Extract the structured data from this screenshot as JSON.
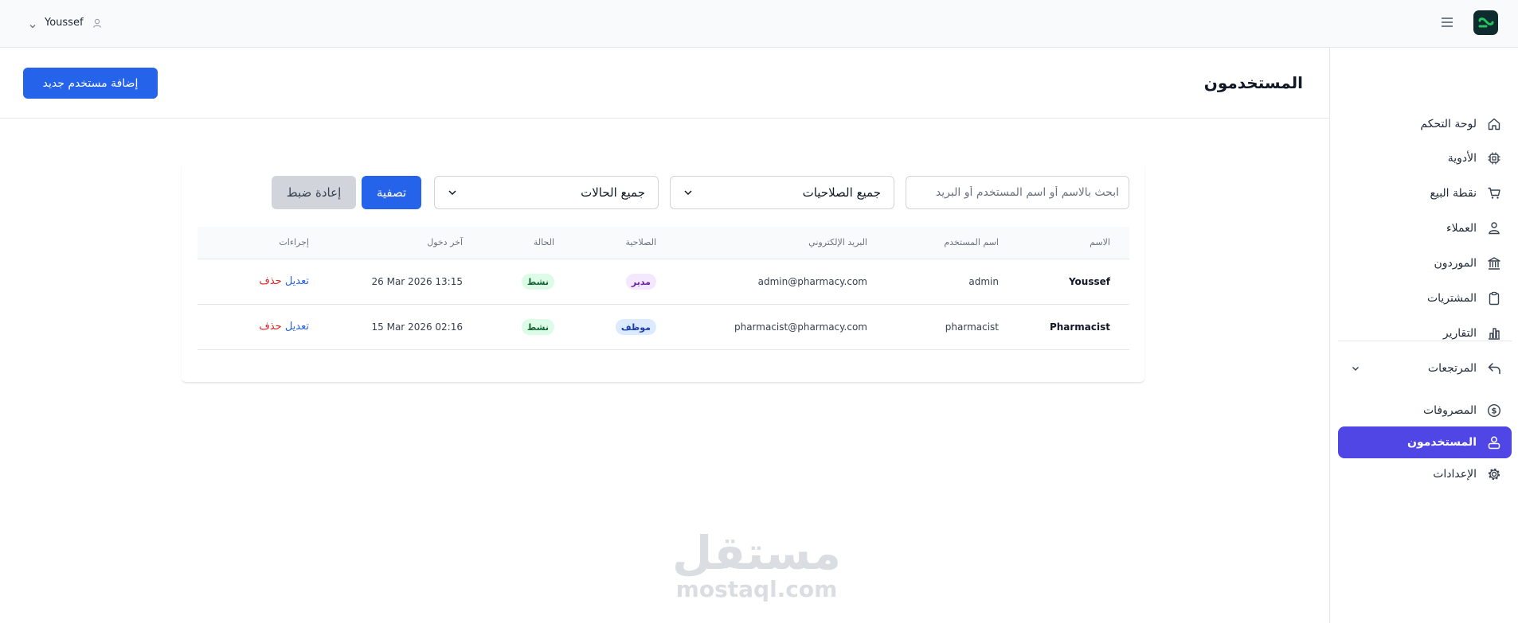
{
  "topbar": {
    "user_name": "Youssef",
    "icons": [
      "chevron-down-icon",
      "user-icon",
      "menu-icon",
      "logo"
    ]
  },
  "sidebar": {
    "items": [
      {
        "label": "لوحة التحكم",
        "icon": "home-icon"
      },
      {
        "label": "الأدوية",
        "icon": "pill-icon"
      },
      {
        "label": "نقطة البيع",
        "icon": "cart-icon"
      },
      {
        "label": "العملاء",
        "icon": "customers-icon"
      },
      {
        "label": "الموردون",
        "icon": "building-icon"
      },
      {
        "label": "المشتريات",
        "icon": "clipboard-icon"
      },
      {
        "label": "التقارير",
        "icon": "chart-icon"
      },
      {
        "label": "المرتجعات",
        "icon": "return-icon"
      },
      {
        "label": "المصروفات",
        "icon": "dollar-icon"
      },
      {
        "label": "المستخدمون",
        "icon": "users-icon",
        "active": true
      },
      {
        "label": "الإعدادات",
        "icon": "gear-icon"
      }
    ]
  },
  "page": {
    "title": "المستخدمون",
    "add_button": "إضافة مستخدم جديد"
  },
  "filters": {
    "search_placeholder": "ابحث بالاسم أو اسم المستخدم أو البريد",
    "role_select": "جميع الصلاحيات",
    "status_select": "جميع الحالات",
    "filter_button": "تصفية",
    "reset_button": "إعادة ضبط"
  },
  "table": {
    "headers": {
      "name": "الاسم",
      "username": "اسم المستخدم",
      "email": "البريد الإلكتروني",
      "role": "الصلاحية",
      "status": "الحالة",
      "last_login": "آخر دخول",
      "actions": "إجراءات"
    },
    "rows": [
      {
        "name": "Youssef",
        "username": "admin",
        "email": "admin@pharmacy.com",
        "role": "مدير",
        "status": "نشط",
        "last_login": "26 Mar 2026 13:15",
        "edit": "تعديل",
        "delete": "حذف"
      },
      {
        "name": "Pharmacist",
        "username": "pharmacist",
        "email": "pharmacist@pharmacy.com",
        "role": "موظف",
        "status": "نشط",
        "last_login": "15 Mar 2026 02:16",
        "edit": "تعديل",
        "delete": "حذف"
      }
    ]
  },
  "watermark": {
    "arabic": "مستقل",
    "latin": "mostaql.com"
  },
  "colors": {
    "primary": "#2563eb",
    "sidebar_active": "#4f46e5",
    "delete": "#dc2626",
    "logo_bg": "#0e2b2d",
    "logo_accent": "#22c55e"
  }
}
